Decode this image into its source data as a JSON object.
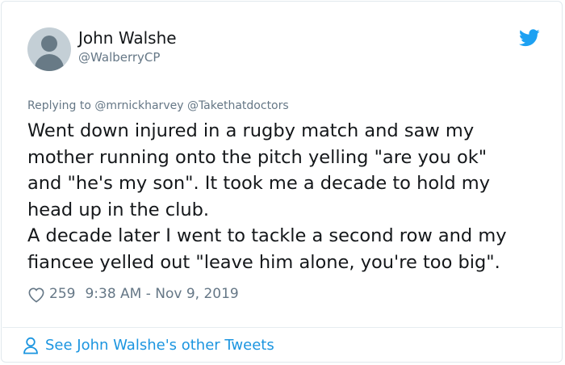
{
  "tweet": {
    "author_name": "John Walshe",
    "author_handle": "@WalberryCP",
    "replying_prefix": "Replying to",
    "replying_mentions": "@mrnickharvey @Takethatdoctors",
    "text_lines": [
      "Went down injured in a rugby match and saw my",
      "mother running onto the pitch yelling \"are you ok\"",
      "and \"he's my son\". It took me a decade to hold my",
      "head up in the club.",
      "A decade later I went to tackle a second row and my",
      "fiancee yelled out \"leave him alone, you're too big\"."
    ],
    "likes": "259",
    "timestamp": "9:38 AM - Nov 9, 2019"
  },
  "footer": {
    "link_label": "See John Walshe's other Tweets"
  },
  "icons": {
    "avatar": "default-avatar-icon",
    "brand": "twitter-bird-icon",
    "like": "heart-icon",
    "profile": "person-icon"
  },
  "colors": {
    "text": "#14171a",
    "muted": "#657786",
    "link": "#1b95e0",
    "twitter_blue": "#1da1f2",
    "border": "#e1e8ed"
  }
}
